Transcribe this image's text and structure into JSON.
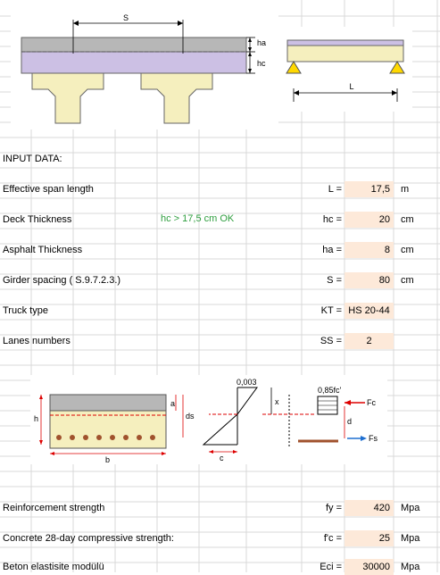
{
  "top_figure": {
    "s_label": "S",
    "ha_label": "ha",
    "hc_label": "hc",
    "l_label": "L"
  },
  "section_title": "INPUT DATA:",
  "rows": [
    {
      "label": "Effective span length",
      "symbol": "L =",
      "value": "17,5",
      "unit": "m"
    },
    {
      "label": "Deck Thickness",
      "symbol": "hc =",
      "value": "20",
      "unit": "cm",
      "check": "hc  >  17,5 cm   OK"
    },
    {
      "label": "Asphalt Thickness",
      "symbol": "ha =",
      "value": "8",
      "unit": "cm"
    },
    {
      "label": "Girder spacing ( S.9.7.2.3.)",
      "symbol": "S =",
      "value": "80",
      "unit": "cm"
    },
    {
      "label": "Truck type",
      "symbol": "KT =",
      "value": "HS 20-44",
      "unit": ""
    },
    {
      "label": "Lanes numbers",
      "symbol": "SS =",
      "value": "2",
      "unit": ""
    }
  ],
  "section_figure": {
    "h_label": "h",
    "a_label": "a",
    "ds_label": "ds",
    "b_label": "b",
    "strain_label": "0,003",
    "x_label": "x",
    "c_label": "c",
    "stress_label": "0,85fc'",
    "fc_label": "Fc",
    "fs_label": "Fs",
    "d_label": "d"
  },
  "rows2": [
    {
      "label": "Reinforcement strength",
      "symbol": "fy =",
      "value": "420",
      "unit": "Mpa"
    },
    {
      "label": "Concrete 28-day compressive strength:",
      "symbol": "f'c =",
      "value": "25",
      "unit": "Mpa"
    },
    {
      "label": "Beton elastisite modülü",
      "symbol": "Eci =",
      "value": "30000",
      "unit": "Mpa"
    }
  ]
}
